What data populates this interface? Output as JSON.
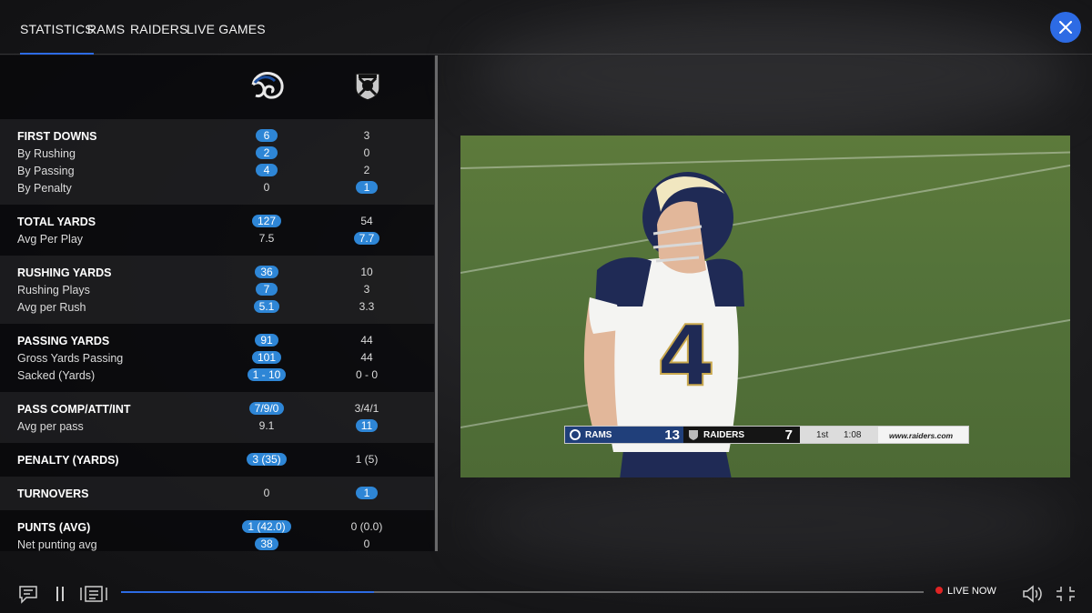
{
  "nav": {
    "tabs": [
      {
        "label": "STATISTICS",
        "active": true
      },
      {
        "label": "RAMS",
        "active": false
      },
      {
        "label": "RAIDERS",
        "active": false
      },
      {
        "label": "LIVE GAMES",
        "active": false
      }
    ],
    "accent": "#2d6be4"
  },
  "teams": {
    "home_logo": "rams-logo-icon",
    "away_logo": "raiders-logo-icon"
  },
  "stat_groups": [
    {
      "rows": [
        {
          "label": "FIRST DOWNS",
          "rams": "6",
          "raiders": "3",
          "leader": "rams"
        },
        {
          "label": "By Rushing",
          "rams": "2",
          "raiders": "0",
          "leader": "rams"
        },
        {
          "label": "By Passing",
          "rams": "4",
          "raiders": "2",
          "leader": "rams"
        },
        {
          "label": "By Penalty",
          "rams": "0",
          "raiders": "1",
          "leader": "raiders"
        }
      ]
    },
    {
      "rows": [
        {
          "label": "TOTAL YARDS",
          "rams": "127",
          "raiders": "54",
          "leader": "rams"
        },
        {
          "label": "Avg Per Play",
          "rams": "7.5",
          "raiders": "7.7",
          "leader": "raiders"
        }
      ]
    },
    {
      "rows": [
        {
          "label": "RUSHING YARDS",
          "rams": "36",
          "raiders": "10",
          "leader": "rams"
        },
        {
          "label": "Rushing Plays",
          "rams": "7",
          "raiders": "3",
          "leader": "rams"
        },
        {
          "label": "Avg per Rush",
          "rams": "5.1",
          "raiders": "3.3",
          "leader": "rams"
        }
      ]
    },
    {
      "rows": [
        {
          "label": "PASSING YARDS",
          "rams": "91",
          "raiders": "44",
          "leader": "rams"
        },
        {
          "label": "Gross Yards Passing",
          "rams": "101",
          "raiders": "44",
          "leader": "rams"
        },
        {
          "label": "Sacked (Yards)",
          "rams": "1 - 10",
          "raiders": "0 - 0",
          "leader": "rams"
        }
      ]
    },
    {
      "rows": [
        {
          "label": "PASS COMP/ATT/INT",
          "rams": "7/9/0",
          "raiders": "3/4/1",
          "leader": "rams"
        },
        {
          "label": "Avg per pass",
          "rams": "9.1",
          "raiders": "11",
          "leader": "raiders"
        }
      ]
    },
    {
      "rows": [
        {
          "label": "PENALTY (YARDS)",
          "rams": "3 (35)",
          "raiders": "1 (5)",
          "leader": "rams"
        }
      ]
    },
    {
      "rows": [
        {
          "label": "TURNOVERS",
          "rams": "0",
          "raiders": "1",
          "leader": "raiders"
        }
      ]
    },
    {
      "rows": [
        {
          "label": "PUNTS (AVG)",
          "rams": "1 (42.0)",
          "raiders": "0 (0.0)",
          "leader": "rams"
        },
        {
          "label": "Net punting avg",
          "rams": "38",
          "raiders": "0",
          "leader": "rams"
        }
      ]
    }
  ],
  "scorebug": {
    "home_team": "RAMS",
    "home_score": "13",
    "away_team": "RAIDERS",
    "away_score": "7",
    "quarter": "1st",
    "clock": "1:08",
    "url": "www.raiders.com"
  },
  "player": {
    "jersey_number": "4"
  },
  "controls": {
    "progress": 0.315,
    "live_label": "LIVE NOW",
    "live_color": "#e02424"
  }
}
